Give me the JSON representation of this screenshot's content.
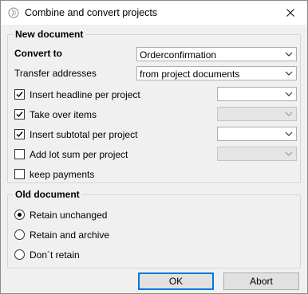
{
  "window": {
    "title": "Combine and convert projects",
    "app_icon": "app-logo-icon",
    "close_icon": "close-icon"
  },
  "new_document": {
    "legend": "New document",
    "convert_to": {
      "label": "Convert to",
      "value": "Orderconfirmation"
    },
    "transfer_addresses": {
      "label": "Transfer addresses",
      "value": "from project documents"
    },
    "options": [
      {
        "label": "Insert headline per project",
        "checked": true,
        "combo_value": "",
        "combo_enabled": true
      },
      {
        "label": "Take over items",
        "checked": true,
        "combo_value": "",
        "combo_enabled": false
      },
      {
        "label": "Insert subtotal per project",
        "checked": true,
        "combo_value": "",
        "combo_enabled": true
      },
      {
        "label": "Add lot sum per project",
        "checked": false,
        "combo_value": "",
        "combo_enabled": false
      }
    ],
    "keep_payments": {
      "label": "keep payments",
      "checked": false
    }
  },
  "old_document": {
    "legend": "Old document",
    "options": [
      {
        "label": "Retain unchanged",
        "selected": true
      },
      {
        "label": "Retain and archive",
        "selected": false
      },
      {
        "label": "Don´t retain",
        "selected": false
      }
    ]
  },
  "buttons": {
    "ok": "OK",
    "abort": "Abort"
  },
  "colors": {
    "focus_border": "#0078d7",
    "dialog_bg": "#f0f0f0"
  }
}
